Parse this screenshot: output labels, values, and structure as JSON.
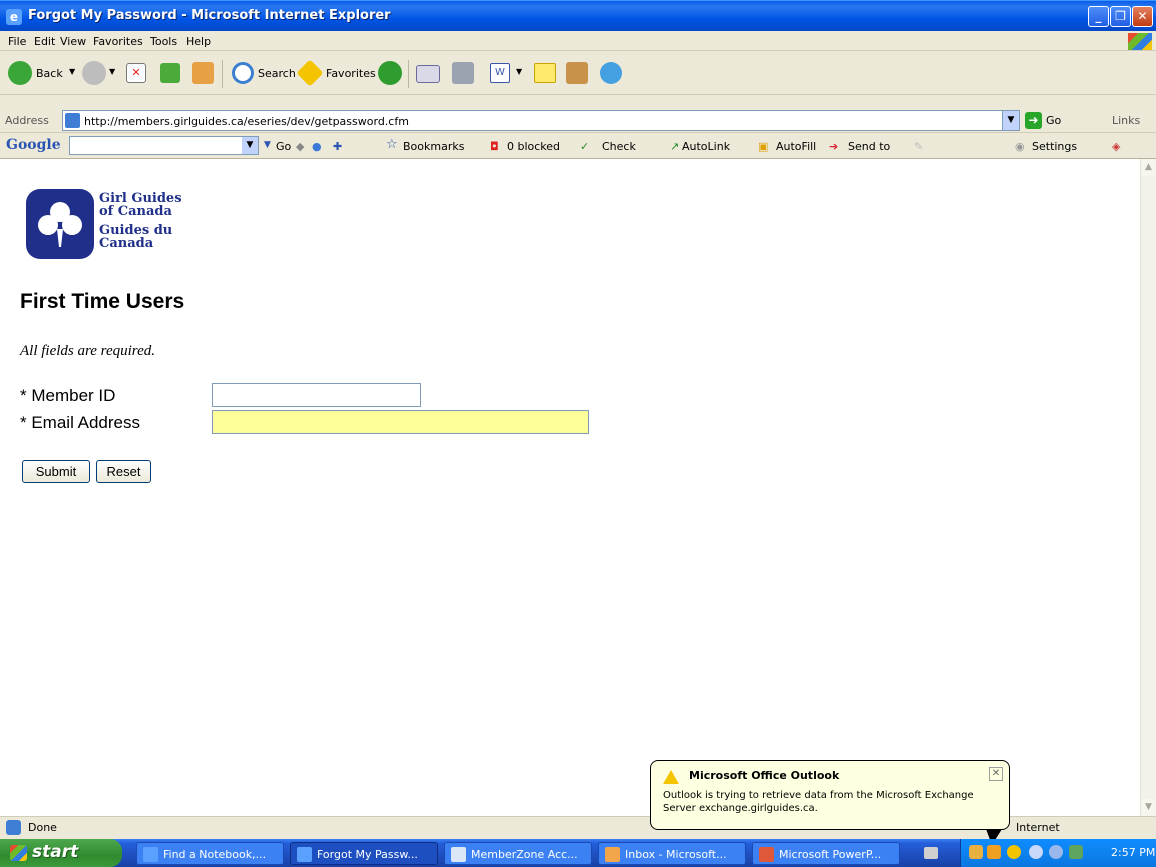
{
  "window": {
    "title": "Forgot My Password - Microsoft Internet Explorer"
  },
  "menu": [
    "File",
    "Edit",
    "View",
    "Favorites",
    "Tools",
    "Help"
  ],
  "toolbar": {
    "back": "Back",
    "search": "Search",
    "favorites": "Favorites"
  },
  "address": {
    "label": "Address",
    "url": "http://members.girlguides.ca/eseries/dev/getpassword.cfm",
    "go": "Go",
    "links": "Links"
  },
  "google": {
    "logo": "Google",
    "go": "Go",
    "bookmarks": "Bookmarks",
    "blocked": "0 blocked",
    "check": "Check",
    "autolink": "AutoLink",
    "autofill": "AutoFill",
    "sendto": "Send to",
    "settings": "Settings"
  },
  "page": {
    "logo_en": "Girl Guides of Canada",
    "logo_fr": "Guides du Canada",
    "title": "First Time Users",
    "note": "All fields are required.",
    "member_label": "* Member ID",
    "email_label": "* Email Address",
    "submit": "Submit",
    "reset": "Reset"
  },
  "status": {
    "text": "Done",
    "zone": "Internet"
  },
  "balloon": {
    "title": "Microsoft Office Outlook",
    "message": "Outlook is trying to retrieve data from the Microsoft Exchange Server exchange.girlguides.ca."
  },
  "taskbar": {
    "start": "start",
    "tasks": [
      "Find a Notebook,...",
      "Forgot My Passw...",
      "MemberZone Acc...",
      "Inbox - Microsoft...",
      "Microsoft PowerP..."
    ],
    "clock": "2:57 PM"
  }
}
